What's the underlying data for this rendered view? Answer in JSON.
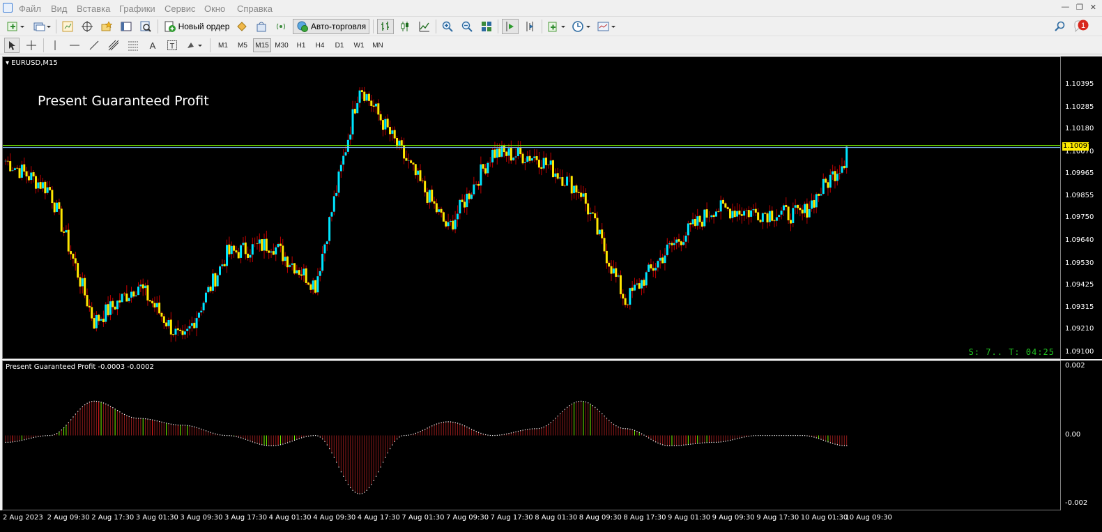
{
  "menu": {
    "items": [
      "Файл",
      "Вид",
      "Вставка",
      "Графики",
      "Сервис",
      "Окно",
      "Справка"
    ]
  },
  "toolbar": {
    "new_order_label": "Новый ордер",
    "autotrade_label": "Авто-торговля",
    "notification_count": "1"
  },
  "timeframes": [
    "M1",
    "M5",
    "M15",
    "M30",
    "H1",
    "H4",
    "D1",
    "W1",
    "MN"
  ],
  "active_timeframe": "M15",
  "chart": {
    "symbol_label": "EURUSD,M15",
    "overlay_title": "Present Guaranteed Profit",
    "timer_text": "S: 7.. T: 04:25",
    "current_price": "1.10097",
    "price_ticks": [
      "1.10395",
      "1.10285",
      "1.10180",
      "1.10070",
      "1.09965",
      "1.09855",
      "1.09750",
      "1.09640",
      "1.09530",
      "1.09425",
      "1.09315",
      "1.09210",
      "1.09100"
    ]
  },
  "indicator": {
    "label": "Present Guaranteed Profit -0.0003 -0.0002",
    "scale_ticks": [
      "0.002",
      "0.00",
      "-0.002"
    ]
  },
  "time_axis": {
    "labels": [
      "2 Aug 2023",
      "2 Aug 09:30",
      "2 Aug 17:30",
      "3 Aug 01:30",
      "3 Aug 09:30",
      "3 Aug 17:30",
      "4 Aug 01:30",
      "4 Aug 09:30",
      "4 Aug 17:30",
      "7 Aug 01:30",
      "7 Aug 09:30",
      "7 Aug 17:30",
      "8 Aug 01:30",
      "8 Aug 09:30",
      "8 Aug 17:30",
      "9 Aug 01:30",
      "9 Aug 09:30",
      "9 Aug 17:30",
      "10 Aug 01:30",
      "10 Aug 09:30"
    ]
  },
  "colors": {
    "chart_bg": "#000000",
    "bull": "#00e5ff",
    "bear": "#ffe600",
    "wick": "#c00000",
    "level_line": "#7cfc00",
    "timer": "#22c822"
  },
  "chart_data": {
    "type": "line",
    "x": [
      "2 Aug 2023",
      "2 Aug 09:30",
      "2 Aug 17:30",
      "3 Aug 01:30",
      "3 Aug 09:30",
      "3 Aug 17:30",
      "4 Aug 01:30",
      "4 Aug 09:30",
      "4 Aug 17:30",
      "7 Aug 01:30",
      "7 Aug 09:30",
      "7 Aug 17:30",
      "8 Aug 01:30",
      "8 Aug 09:30",
      "8 Aug 17:30",
      "9 Aug 01:30",
      "9 Aug 09:30",
      "9 Aug 17:30",
      "10 Aug 01:30",
      "10 Aug 09:30"
    ],
    "series": [
      {
        "values": [
          1.1003,
          1.0989,
          1.0925,
          1.0943,
          1.0915,
          1.0958,
          1.0963,
          1.0943,
          1.104,
          1.1005,
          1.097,
          1.1007,
          1.1005,
          1.0988,
          1.0935,
          1.0961,
          1.098,
          1.0978,
          1.0977,
          1.1005
        ]
      }
    ],
    "ylim": [
      1.091,
      1.1043
    ],
    "indicator": {
      "values": [
        -0.0002,
        0.0,
        0.001,
        0.0005,
        0.0003,
        0.0,
        -0.0003,
        0.0,
        -0.0017,
        0.0,
        0.0004,
        0.0,
        0.0002,
        0.001,
        0.0002,
        -0.0003,
        -0.0002,
        0.0,
        0.0,
        -0.0003
      ],
      "ylim": [
        -0.002,
        0.002
      ]
    }
  }
}
